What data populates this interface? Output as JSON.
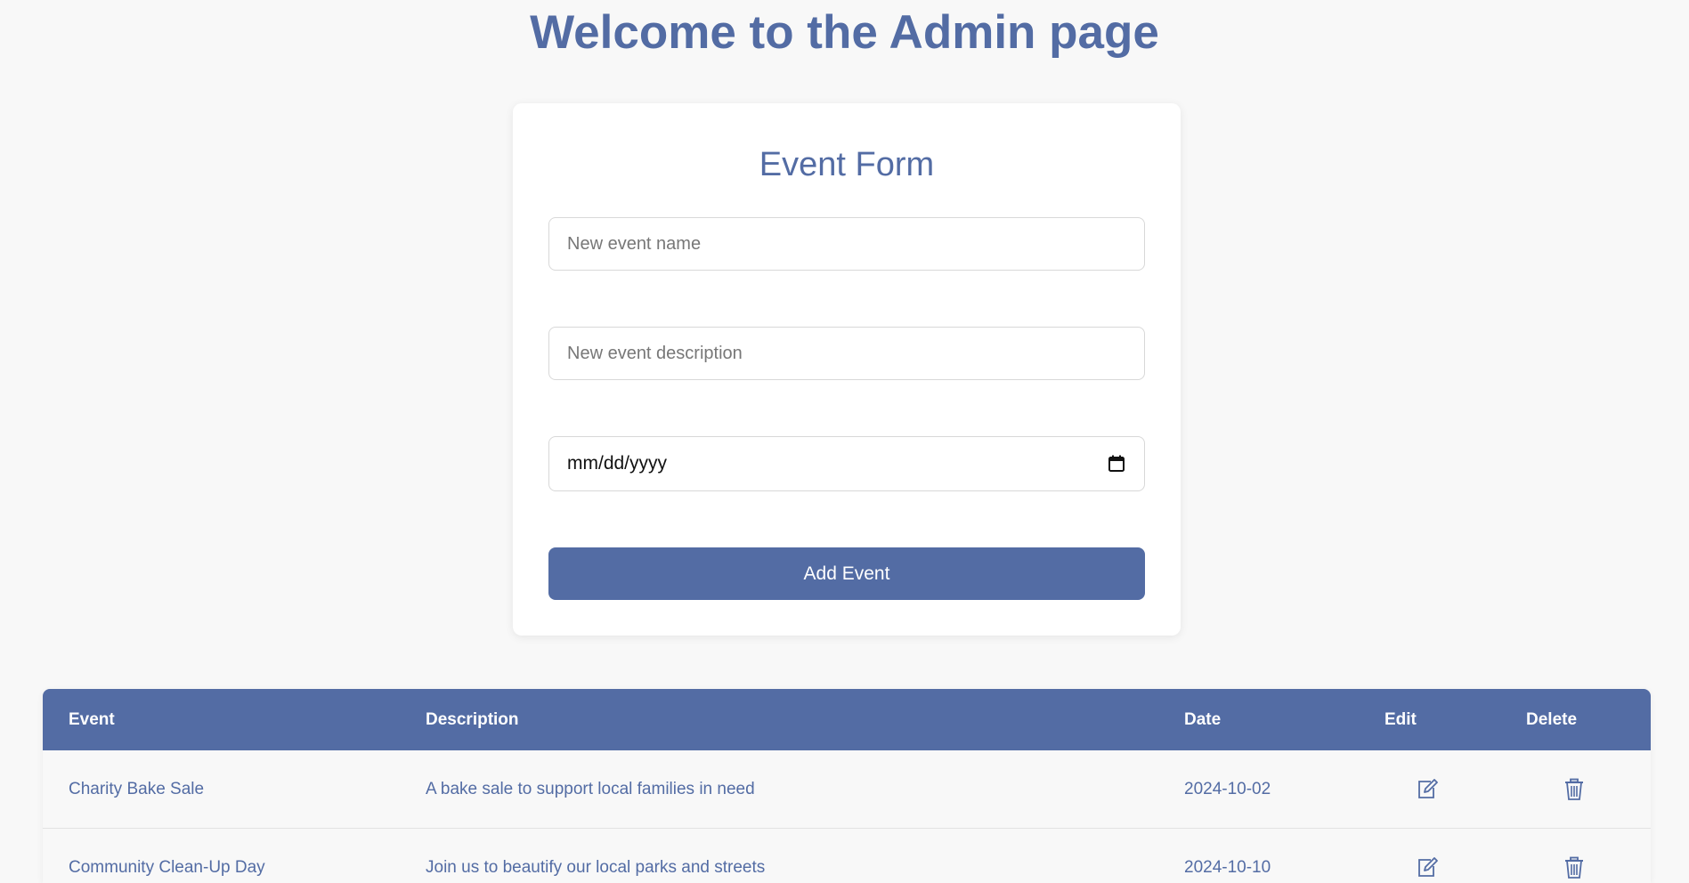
{
  "page": {
    "title": "Welcome to the Admin page"
  },
  "form": {
    "title": "Event Form",
    "name_placeholder": "New event name",
    "description_placeholder": "New event description",
    "date_placeholder": "mm/dd/yyyy",
    "calendar_icon": "calendar-icon",
    "submit_label": "Add Event"
  },
  "table": {
    "headers": [
      "Event",
      "Description",
      "Date",
      "Edit",
      "Delete"
    ],
    "rows": [
      {
        "event": "Charity Bake Sale",
        "description": "A bake sale to support local families in need",
        "date": "2024-10-02",
        "edit_icon": "edit-icon",
        "delete_icon": "trash-icon"
      },
      {
        "event": "Community Clean-Up Day",
        "description": "Join us to beautify our local parks and streets",
        "date": "2024-10-10",
        "edit_icon": "edit-icon",
        "delete_icon": "trash-icon"
      }
    ]
  },
  "colors": {
    "accent": "#536ca4",
    "background": "#f8f8f8",
    "card": "#ffffff"
  }
}
